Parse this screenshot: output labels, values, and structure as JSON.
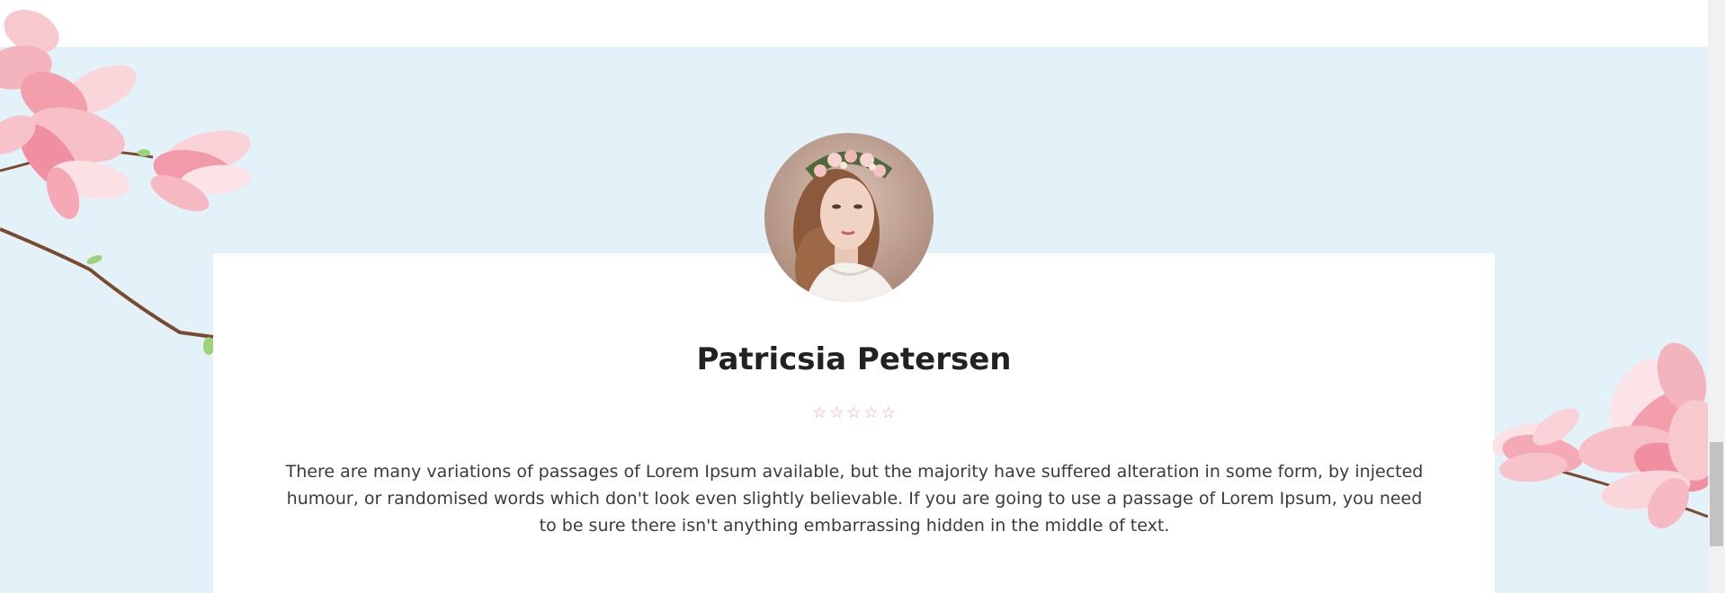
{
  "testimonial": {
    "name": "Patricsia Petersen",
    "rating": 5,
    "stars": [
      "☆",
      "☆",
      "☆",
      "☆",
      "☆"
    ],
    "text": "There are many variations of passages of Lorem Ipsum available, but the majority have suffered alteration in some form, by injected humour, or randomised words which don't look even slightly believable. If you are going to use a passage of Lorem Ipsum, you need to be sure there isn't anything embarrassing hidden in the middle of text."
  },
  "colors": {
    "section_background": "#e3f2f8",
    "card_background": "#ffffff",
    "star_color": "#f4a9b3",
    "name_color": "#222222"
  },
  "icons": {
    "rating": "star-icon",
    "decoration_left": "magnolia-branch-left",
    "decoration_right": "magnolia-branch-right"
  }
}
